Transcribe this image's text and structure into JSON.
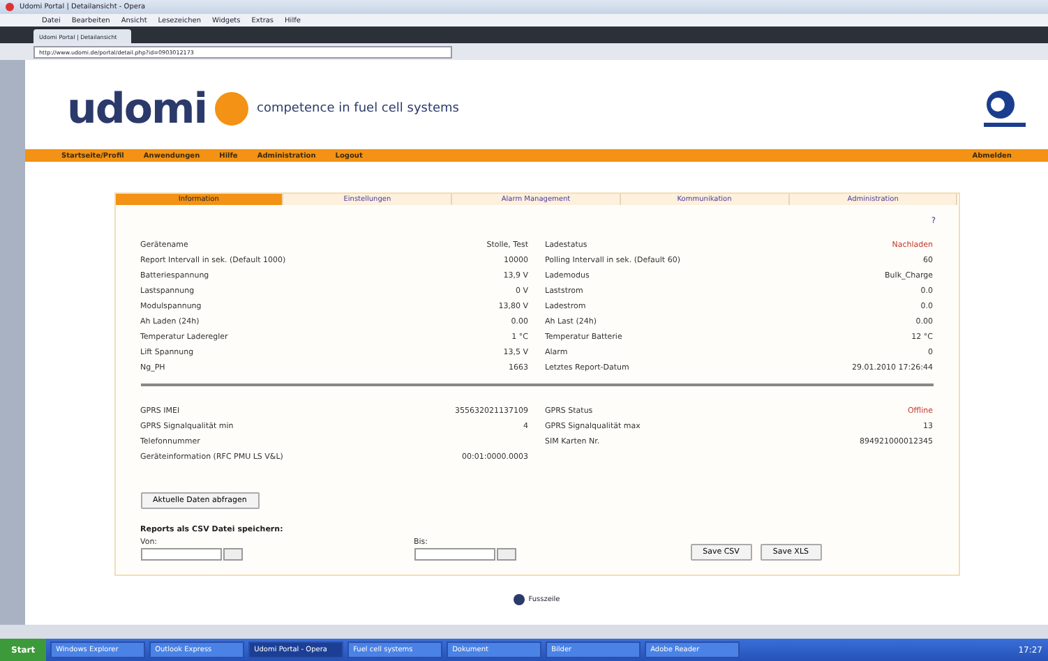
{
  "window": {
    "title": "Udomi Portal | Detailansicht - Opera"
  },
  "menu": [
    "Datei",
    "Bearbeiten",
    "Ansicht",
    "Lesezeichen",
    "Widgets",
    "Extras",
    "Hilfe"
  ],
  "browser_tab": "Udomi Portal | Detailansicht",
  "address": "http://www.udomi.de/portal/detail.php?id=0903012173",
  "logo": {
    "name": "udomi",
    "tagline": "competence in fuel cell systems"
  },
  "nav": {
    "items": [
      "Startseite/Profil",
      "Anwendungen",
      "Hilfe",
      "Administration",
      "Logout"
    ],
    "right": "Abmelden"
  },
  "tabs": [
    {
      "label": "Information",
      "selected": true
    },
    {
      "label": "Einstellungen",
      "selected": false
    },
    {
      "label": "Alarm Management",
      "selected": false
    },
    {
      "label": "Kommunikation",
      "selected": false
    },
    {
      "label": "Administration",
      "selected": false
    }
  ],
  "help_link": "?",
  "left_rows": [
    {
      "label": "Gerätename",
      "value": "Stolle, Test"
    },
    {
      "label": "Report Intervall in sek. (Default 1000)",
      "value": "10000"
    },
    {
      "label": "Batteriespannung",
      "value": "13,9 V"
    },
    {
      "label": "Lastspannung",
      "value": "0 V"
    },
    {
      "label": "Modulspannung",
      "value": "13,80 V"
    },
    {
      "label": "Ah Laden (24h)",
      "value": "0.00"
    },
    {
      "label": "Temperatur Laderegler",
      "value": "1 °C"
    },
    {
      "label": "Lift Spannung",
      "value": "13,5 V"
    },
    {
      "label": "Ng_PH",
      "value": "1663"
    }
  ],
  "right_rows": [
    {
      "label": "Ladestatus",
      "value": "Nachladen",
      "alert": true
    },
    {
      "label": "Polling Intervall in sek. (Default 60)",
      "value": "60",
      "alert": false
    },
    {
      "label": "Lademodus",
      "value": "Bulk_Charge",
      "alert": false
    },
    {
      "label": "Laststrom",
      "value": "0.0",
      "alert": false
    },
    {
      "label": "Ladestrom",
      "value": "0.0",
      "alert": false
    },
    {
      "label": "Ah Last (24h)",
      "value": "0.00",
      "alert": false
    },
    {
      "label": "Temperatur Batterie",
      "value": "12 °C",
      "alert": false
    },
    {
      "label": "Alarm",
      "value": "0",
      "alert": false
    },
    {
      "label": "Letztes Report-Datum",
      "value": "29.01.2010 17:26:44",
      "alert": false
    }
  ],
  "gprs_left": [
    {
      "label": "GPRS IMEI",
      "value": "355632021137109"
    },
    {
      "label": "GPRS Signalqualität min",
      "value": "4"
    },
    {
      "label": "Telefonnummer"
    },
    {
      "label": "Geräteinformation (RFC PMU LS V&L)",
      "value": "00:01:0000.0003"
    }
  ],
  "gprs_right": [
    {
      "label": "GPRS Status",
      "value": "Offline",
      "alert": true
    },
    {
      "label": "GPRS Signalqualität max",
      "value": "13",
      "alert": false
    },
    {
      "label": "SIM Karten Nr.",
      "value": "894921000012345",
      "alert": false
    }
  ],
  "refresh_button": "Aktuelle Daten abfragen",
  "export": {
    "title": "Reports als CSV Datei speichern:",
    "from_label": "Von:",
    "to_label": "Bis:",
    "buttons": [
      "Save CSV",
      "Save XLS"
    ]
  },
  "footer_link": "Fusszeile",
  "taskbar": {
    "start": "Start",
    "items": [
      {
        "label": "Windows Explorer",
        "selected": false
      },
      {
        "label": "Outlook Express",
        "selected": false
      },
      {
        "label": "Udomi Portal - Opera",
        "selected": true
      },
      {
        "label": "Fuel cell systems",
        "selected": false
      },
      {
        "label": "Dokument",
        "selected": false
      },
      {
        "label": "Bilder",
        "selected": false
      },
      {
        "label": "Adobe Reader",
        "selected": false
      }
    ],
    "clock": "17:27"
  }
}
